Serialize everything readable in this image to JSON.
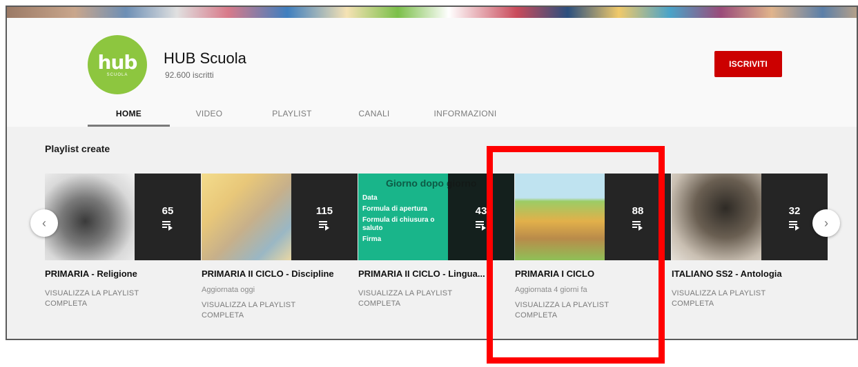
{
  "channel": {
    "logo_text": "hub",
    "logo_subtext": "SCUOLA",
    "name": "HUB Scuola",
    "subscribers": "92.600 iscritti",
    "subscribe_label": "ISCRIVITI"
  },
  "tabs": [
    {
      "label": "HOME",
      "active": true
    },
    {
      "label": "VIDEO",
      "active": false
    },
    {
      "label": "PLAYLIST",
      "active": false
    },
    {
      "label": "CANALI",
      "active": false
    },
    {
      "label": "INFORMAZIONI",
      "active": false
    }
  ],
  "section": {
    "title": "Playlist create"
  },
  "playlists": [
    {
      "title": "PRIMARIA - Religione",
      "count": "65",
      "updated": "",
      "link": "VISUALIZZA LA PLAYLIST COMPLETA"
    },
    {
      "title": "PRIMARIA II CICLO - Discipline",
      "count": "115",
      "updated": "Aggiornata oggi",
      "link": "VISUALIZZA LA PLAYLIST COMPLETA"
    },
    {
      "title": "PRIMARIA II CICLO - Lingua...",
      "count": "43",
      "updated": "",
      "link": "VISUALIZZA LA PLAYLIST COMPLETA",
      "thumb_text": [
        "Giorno dopo giorno",
        "Data",
        "Formula di apertura",
        "Formula di chiusura o saluto",
        "Firma"
      ]
    },
    {
      "title": "PRIMARIA I CICLO",
      "count": "88",
      "updated": "Aggiornata 4 giorni fa",
      "link": "VISUALIZZA LA PLAYLIST COMPLETA"
    },
    {
      "title": "ITALIANO SS2 - Antologia",
      "count": "32",
      "updated": "",
      "link": "VISUALIZZA LA PLAYLIST COMPLETA"
    }
  ],
  "colors": {
    "brand_green": "#8dc63f",
    "subscribe_red": "#cc0000",
    "highlight_red": "#ff0000"
  }
}
